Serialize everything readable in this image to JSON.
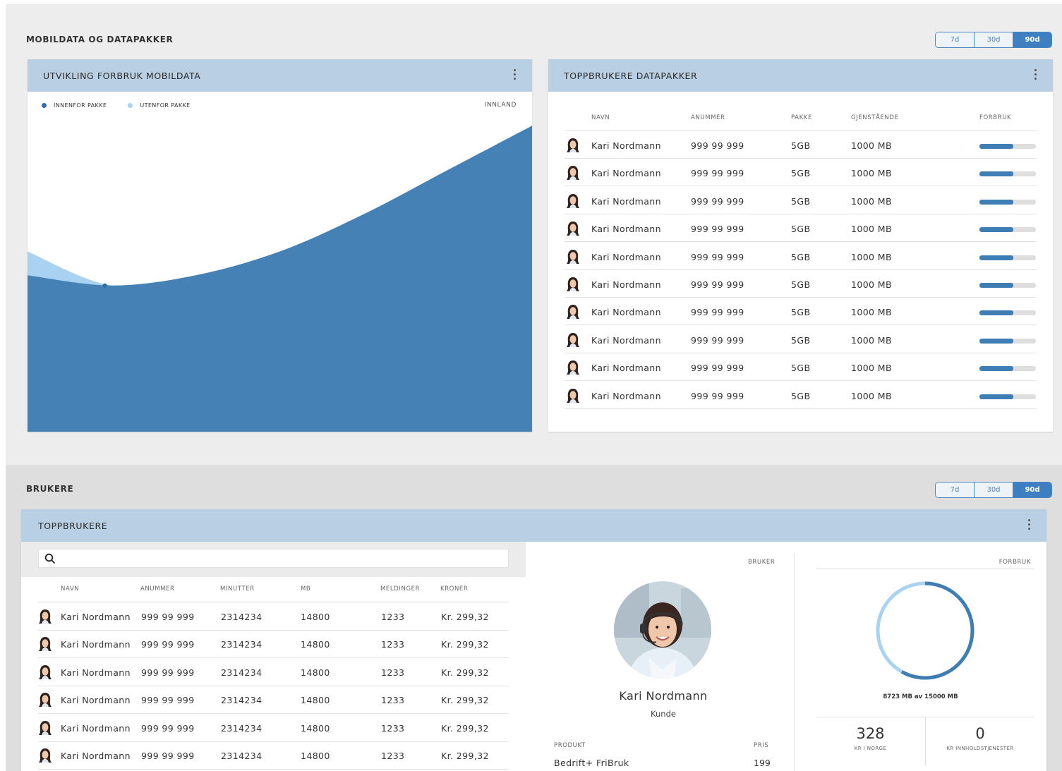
{
  "mobildata_section": {
    "title": "MOBILDATA OG DATAPAKKER",
    "ranges": [
      "7d",
      "30d",
      "90d"
    ],
    "active_range": "90d"
  },
  "chart_card": {
    "title": "UTVIKLING FORBRUK MOBILDATA",
    "legend": [
      {
        "label": "INNENFOR PAKKE",
        "color": "#3f7db5"
      },
      {
        "label": "UTENFOR PAKKE",
        "color": "#a8d1f2"
      }
    ],
    "region_label": "INNLAND"
  },
  "chart_data": {
    "type": "area",
    "title": "UTVIKLING FORBRUK MOBILDATA",
    "xlabel": "",
    "ylabel": "",
    "legend_placement": "top-left",
    "grid": false,
    "series": [
      {
        "name": "INNENFOR PAKKE",
        "color": "#4581b5",
        "values": [
          46,
          43,
          46,
          53,
          64,
          77,
          90
        ]
      },
      {
        "name": "UTENFOR PAKKE",
        "color": "#a8d1f2",
        "values": [
          53,
          43,
          46,
          53,
          64,
          77,
          90
        ]
      }
    ],
    "x": [
      0,
      1,
      2,
      3,
      4,
      5,
      6
    ],
    "ylim": [
      0,
      100
    ]
  },
  "top_data_card": {
    "title": "TOPPBRUKERE DATAPAKKER",
    "columns": [
      "NAVN",
      "ANUMMER",
      "PAKKE",
      "GJENSTÅENDE",
      "FORBRUK"
    ],
    "rows": [
      {
        "name": "Kari Nordmann",
        "number": "999 99 999",
        "package": "5GB",
        "remaining": "1000 MB",
        "usage": 0.6
      },
      {
        "name": "Kari Nordmann",
        "number": "999 99 999",
        "package": "5GB",
        "remaining": "1000 MB",
        "usage": 0.6
      },
      {
        "name": "Kari Nordmann",
        "number": "999 99 999",
        "package": "5GB",
        "remaining": "1000 MB",
        "usage": 0.6
      },
      {
        "name": "Kari Nordmann",
        "number": "999 99 999",
        "package": "5GB",
        "remaining": "1000 MB",
        "usage": 0.6
      },
      {
        "name": "Kari Nordmann",
        "number": "999 99 999",
        "package": "5GB",
        "remaining": "1000 MB",
        "usage": 0.6
      },
      {
        "name": "Kari Nordmann",
        "number": "999 99 999",
        "package": "5GB",
        "remaining": "1000 MB",
        "usage": 0.6
      },
      {
        "name": "Kari Nordmann",
        "number": "999 99 999",
        "package": "5GB",
        "remaining": "1000 MB",
        "usage": 0.6
      },
      {
        "name": "Kari Nordmann",
        "number": "999 99 999",
        "package": "5GB",
        "remaining": "1000 MB",
        "usage": 0.6
      },
      {
        "name": "Kari Nordmann",
        "number": "999 99 999",
        "package": "5GB",
        "remaining": "1000 MB",
        "usage": 0.6
      },
      {
        "name": "Kari Nordmann",
        "number": "999 99 999",
        "package": "5GB",
        "remaining": "1000 MB",
        "usage": 0.6
      }
    ]
  },
  "brukere_section": {
    "title": "BRUKERE",
    "ranges": [
      "7d",
      "30d",
      "90d"
    ],
    "active_range": "90d"
  },
  "users_card": {
    "title": "TOPPBRUKERE",
    "search_placeholder": "",
    "columns": [
      "NAVN",
      "ANUMMER",
      "MINUTTER",
      "MB",
      "MELDINGER",
      "KRONER"
    ],
    "rows": [
      {
        "name": "Kari Nordmann",
        "number": "999 99 999",
        "minutes": "2314234",
        "mb": "14800",
        "messages": "1233",
        "kroner": "Kr. 299,32"
      },
      {
        "name": "Kari Nordmann",
        "number": "999 99 999",
        "minutes": "2314234",
        "mb": "14800",
        "messages": "1233",
        "kroner": "Kr. 299,32"
      },
      {
        "name": "Kari Nordmann",
        "number": "999 99 999",
        "minutes": "2314234",
        "mb": "14800",
        "messages": "1233",
        "kroner": "Kr. 299,32"
      },
      {
        "name": "Kari Nordmann",
        "number": "999 99 999",
        "minutes": "2314234",
        "mb": "14800",
        "messages": "1233",
        "kroner": "Kr. 299,32"
      },
      {
        "name": "Kari Nordmann",
        "number": "999 99 999",
        "minutes": "2314234",
        "mb": "14800",
        "messages": "1233",
        "kroner": "Kr. 299,32"
      },
      {
        "name": "Kari Nordmann",
        "number": "999 99 999",
        "minutes": "2314234",
        "mb": "14800",
        "messages": "1233",
        "kroner": "Kr. 299,32"
      }
    ],
    "user_panel": {
      "label": "BRUKER",
      "name": "Kari Nordmann",
      "role": "Kunde",
      "product_label": "PRODUKT",
      "product_value": "Bedrift+ FriBruk",
      "price_label": "PRIS",
      "price_value": "199"
    },
    "usage_panel": {
      "label": "FORBRUK",
      "used_mb": 8723,
      "total_mb": 15000,
      "summary": "8723 MB av 15000 MB",
      "stat1_value": "328",
      "stat1_label": "KR I NORGE",
      "stat2_value": "0",
      "stat2_label": "KR INNHOLDSTJENESTER"
    }
  }
}
